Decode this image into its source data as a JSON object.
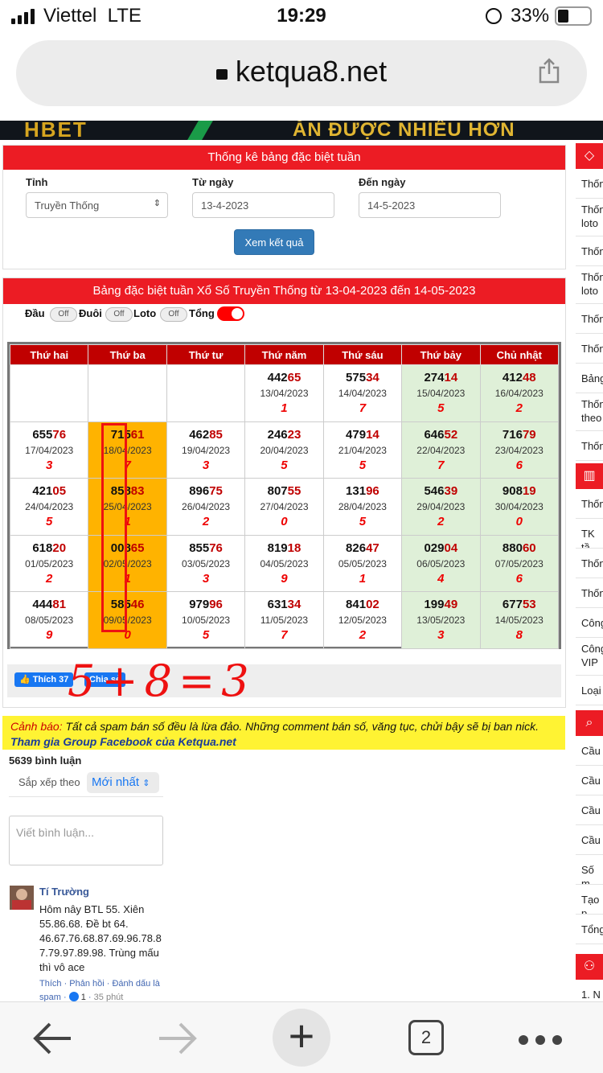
{
  "status": {
    "carrier": "Viettel",
    "network": "LTE",
    "time": "19:29",
    "battery": "33%"
  },
  "browser": {
    "url": "ketqua8.net",
    "tab_count": "2"
  },
  "banner": {
    "left_text": "HBET",
    "right_text": "ĂN ĐƯỢC NHIỀU HƠN"
  },
  "filter": {
    "title": "Thống kê bảng đặc biệt tuần",
    "province_label": "Tỉnh",
    "province_value": "Truyền Thống",
    "from_label": "Từ ngày",
    "from_value": "13-4-2023",
    "to_label": "Đến ngày",
    "to_value": "14-5-2023",
    "submit": "Xem kết quả"
  },
  "board": {
    "title": "Bảng đặc biệt tuần Xổ Số Truyền Thống từ 13-04-2023 đến 14-05-2023",
    "toggles": [
      {
        "label": "Đầu",
        "state": "Off"
      },
      {
        "label": "Đuôi",
        "state": "Off"
      },
      {
        "label": "Loto",
        "state": "Off"
      },
      {
        "label": "Tổng",
        "state": ""
      }
    ],
    "days": [
      "Thứ hai",
      "Thứ ba",
      "Thứ tư",
      "Thứ năm",
      "Thứ sáu",
      "Thứ bảy",
      "Chủ nhật"
    ],
    "rows": [
      [
        null,
        null,
        null,
        {
          "head": "442",
          "tail": "65",
          "date": "13/04/2023",
          "sum": "1"
        },
        {
          "head": "575",
          "tail": "34",
          "date": "14/04/2023",
          "sum": "7"
        },
        {
          "head": "274",
          "tail": "14",
          "date": "15/04/2023",
          "sum": "5"
        },
        {
          "head": "412",
          "tail": "48",
          "date": "16/04/2023",
          "sum": "2"
        }
      ],
      [
        {
          "head": "655",
          "tail": "76",
          "date": "17/04/2023",
          "sum": "3"
        },
        {
          "head": "715",
          "tail": "61",
          "date": "18/04/2023",
          "sum": "7"
        },
        {
          "head": "462",
          "tail": "85",
          "date": "19/04/2023",
          "sum": "3"
        },
        {
          "head": "246",
          "tail": "23",
          "date": "20/04/2023",
          "sum": "5"
        },
        {
          "head": "479",
          "tail": "14",
          "date": "21/04/2023",
          "sum": "5"
        },
        {
          "head": "646",
          "tail": "52",
          "date": "22/04/2023",
          "sum": "7"
        },
        {
          "head": "716",
          "tail": "79",
          "date": "23/04/2023",
          "sum": "6"
        }
      ],
      [
        {
          "head": "421",
          "tail": "05",
          "date": "24/04/2023",
          "sum": "5"
        },
        {
          "head": "858",
          "tail": "83",
          "date": "25/04/2023",
          "sum": "1"
        },
        {
          "head": "896",
          "tail": "75",
          "date": "26/04/2023",
          "sum": "2"
        },
        {
          "head": "807",
          "tail": "55",
          "date": "27/04/2023",
          "sum": "0"
        },
        {
          "head": "131",
          "tail": "96",
          "date": "28/04/2023",
          "sum": "5"
        },
        {
          "head": "546",
          "tail": "39",
          "date": "29/04/2023",
          "sum": "2"
        },
        {
          "head": "908",
          "tail": "19",
          "date": "30/04/2023",
          "sum": "0"
        }
      ],
      [
        {
          "head": "618",
          "tail": "20",
          "date": "01/05/2023",
          "sum": "2"
        },
        {
          "head": "008",
          "tail": "65",
          "date": "02/05/2023",
          "sum": "1"
        },
        {
          "head": "855",
          "tail": "76",
          "date": "03/05/2023",
          "sum": "3"
        },
        {
          "head": "819",
          "tail": "18",
          "date": "04/05/2023",
          "sum": "9"
        },
        {
          "head": "826",
          "tail": "47",
          "date": "05/05/2023",
          "sum": "1"
        },
        {
          "head": "029",
          "tail": "04",
          "date": "06/05/2023",
          "sum": "4"
        },
        {
          "head": "880",
          "tail": "60",
          "date": "07/05/2023",
          "sum": "6"
        }
      ],
      [
        {
          "head": "444",
          "tail": "81",
          "date": "08/05/2023",
          "sum": "9"
        },
        {
          "head": "585",
          "tail": "46",
          "date": "09/05/2023",
          "sum": "0"
        },
        {
          "head": "979",
          "tail": "96",
          "date": "10/05/2023",
          "sum": "5"
        },
        {
          "head": "631",
          "tail": "34",
          "date": "11/05/2023",
          "sum": "7"
        },
        {
          "head": "841",
          "tail": "02",
          "date": "12/05/2023",
          "sum": "2"
        },
        {
          "head": "199",
          "tail": "49",
          "date": "13/05/2023",
          "sum": "3"
        },
        {
          "head": "677",
          "tail": "53",
          "date": "14/05/2023",
          "sum": "8"
        }
      ]
    ],
    "annotation": "5+8=3"
  },
  "share": {
    "like": "Thích 37",
    "share": "Chia sẻ"
  },
  "warning": {
    "label": "Cảnh báo:",
    "text": " Tất cả spam bán số đều là lừa đảo. Những comment bán số, văng tục, chửi bậy sẽ bị ban nick.",
    "group_link": "Tham gia Group Facebook của Ketqua.net"
  },
  "comments": {
    "count": "5639 bình luận",
    "sort_label": "Sắp xếp theo",
    "sort_value": "Mới nhất",
    "placeholder": "Viết bình luận...",
    "items": [
      {
        "author": "Tí Trường",
        "lines": [
          "Hôm nây BTL 55. Xiên",
          "55.86.68. Đề bt 64.",
          "46.67.76.68.87.69.96.78.8",
          "7.79.97.89.98. Trùng mấu",
          "thì vô ace"
        ],
        "actions": "Thích · Phản hồi · Đánh dấu là",
        "actions2": "spam · ",
        "likes": "1",
        "age": "35 phút"
      }
    ]
  },
  "sidebar": {
    "group1": [
      "Thốn",
      "Thốn loto",
      "Thốn",
      "Thốn loto",
      "Thốn",
      "Thốn",
      "Bảng",
      "Thốn theo",
      "Thốn"
    ],
    "group2": [
      "Thốn",
      "TK tầ",
      "Thốn",
      "Thốn",
      "Công",
      "Công VIP",
      "Loại"
    ],
    "group3": [
      "Cầu",
      "Cầu",
      "Cầu",
      "Cầu",
      "Số m",
      "Tạo p",
      "Tổng"
    ],
    "group4": [
      "1. N"
    ]
  }
}
